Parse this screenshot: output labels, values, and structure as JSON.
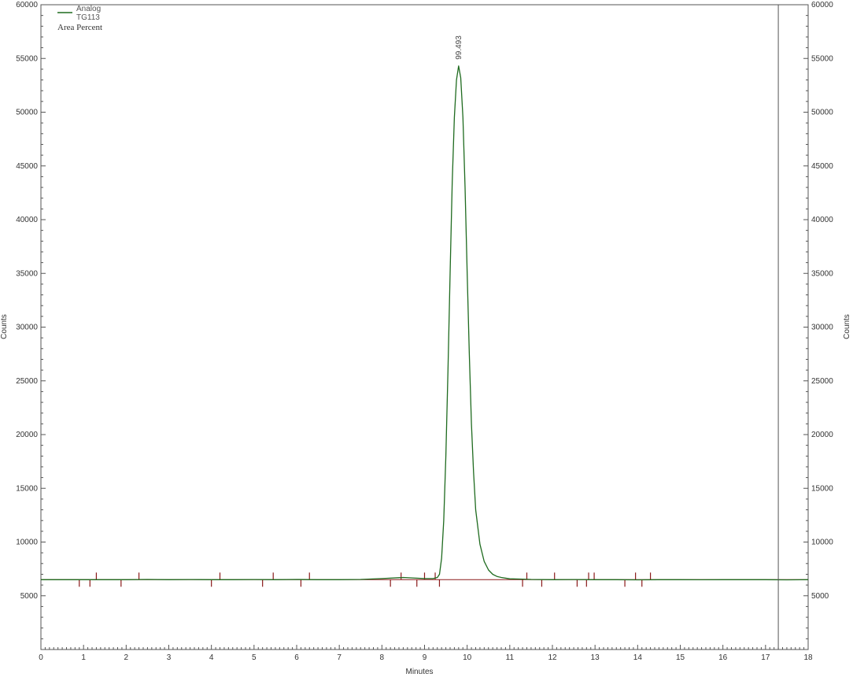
{
  "chart_data": {
    "type": "line",
    "title": "",
    "xlabel": "Minutes",
    "ylabel": "Counts",
    "ylabel_right": "Counts",
    "xlim": [
      0,
      18
    ],
    "ylim": [
      0,
      60000
    ],
    "x_ticks": [
      0,
      1,
      2,
      3,
      4,
      5,
      6,
      7,
      8,
      9,
      10,
      11,
      12,
      13,
      14,
      15,
      16,
      17,
      18
    ],
    "y_ticks": [
      5000,
      10000,
      15000,
      20000,
      25000,
      30000,
      35000,
      40000,
      45000,
      50000,
      55000,
      60000
    ],
    "grid": false,
    "legend": {
      "placement": "top-left",
      "entries": [
        "Analog",
        "TG113"
      ],
      "method": "Area Percent"
    },
    "series": [
      {
        "name": "Analog TG113",
        "color": "#1f6b1f",
        "x": [
          0,
          0.5,
          1.0,
          1.5,
          2.0,
          2.5,
          3.0,
          3.5,
          4.0,
          4.5,
          5.0,
          5.5,
          6.0,
          6.5,
          7.0,
          7.5,
          8.0,
          8.5,
          9.0,
          9.2,
          9.3,
          9.35,
          9.4,
          9.45,
          9.5,
          9.55,
          9.6,
          9.65,
          9.7,
          9.75,
          9.8,
          9.85,
          9.9,
          9.95,
          10.0,
          10.05,
          10.1,
          10.15,
          10.2,
          10.3,
          10.4,
          10.5,
          10.6,
          10.7,
          10.8,
          11.0,
          11.3,
          11.5,
          12.0,
          12.5,
          13.0,
          13.5,
          14.0,
          14.5,
          15.0,
          15.5,
          16.0,
          16.5,
          17.0,
          17.5,
          18.0
        ],
        "y": [
          6500,
          6500,
          6500,
          6500,
          6500,
          6520,
          6500,
          6510,
          6500,
          6500,
          6510,
          6500,
          6520,
          6500,
          6500,
          6520,
          6600,
          6700,
          6600,
          6600,
          6700,
          7000,
          8500,
          12000,
          18000,
          26000,
          35000,
          43500,
          49500,
          53000,
          54300,
          53200,
          49500,
          43000,
          35000,
          27500,
          21000,
          16500,
          13000,
          9800,
          8200,
          7400,
          7000,
          6800,
          6700,
          6580,
          6550,
          6520,
          6500,
          6510,
          6500,
          6500,
          6480,
          6500,
          6500,
          6490,
          6500,
          6500,
          6500,
          6480,
          6500
        ]
      }
    ],
    "baseline": {
      "color": "#8b1a1a",
      "x": [
        0,
        18
      ],
      "y": [
        6500,
        6500
      ]
    },
    "peak_annotations": [
      {
        "x": 9.8,
        "y": 54300,
        "label": "99.493"
      }
    ],
    "integration_marks": {
      "color": "#8b1a1a",
      "x": [
        0.9,
        1.15,
        1.3,
        1.88,
        2.3,
        4.0,
        4.2,
        5.2,
        5.45,
        6.1,
        6.3,
        8.2,
        8.45,
        8.82,
        9.0,
        9.25,
        9.35,
        11.3,
        11.4,
        11.75,
        12.05,
        12.58,
        12.8,
        12.85,
        12.98,
        13.7,
        13.95,
        14.1,
        14.3
      ],
      "dir": [
        -1,
        -1,
        1,
        -1,
        1,
        -1,
        1,
        -1,
        1,
        -1,
        1,
        -1,
        1,
        -1,
        1,
        1,
        -1,
        -1,
        1,
        -1,
        1,
        -1,
        -1,
        1,
        1,
        -1,
        1,
        -1,
        1
      ]
    },
    "cursor": {
      "x": 17.3,
      "color": "#555555"
    }
  }
}
